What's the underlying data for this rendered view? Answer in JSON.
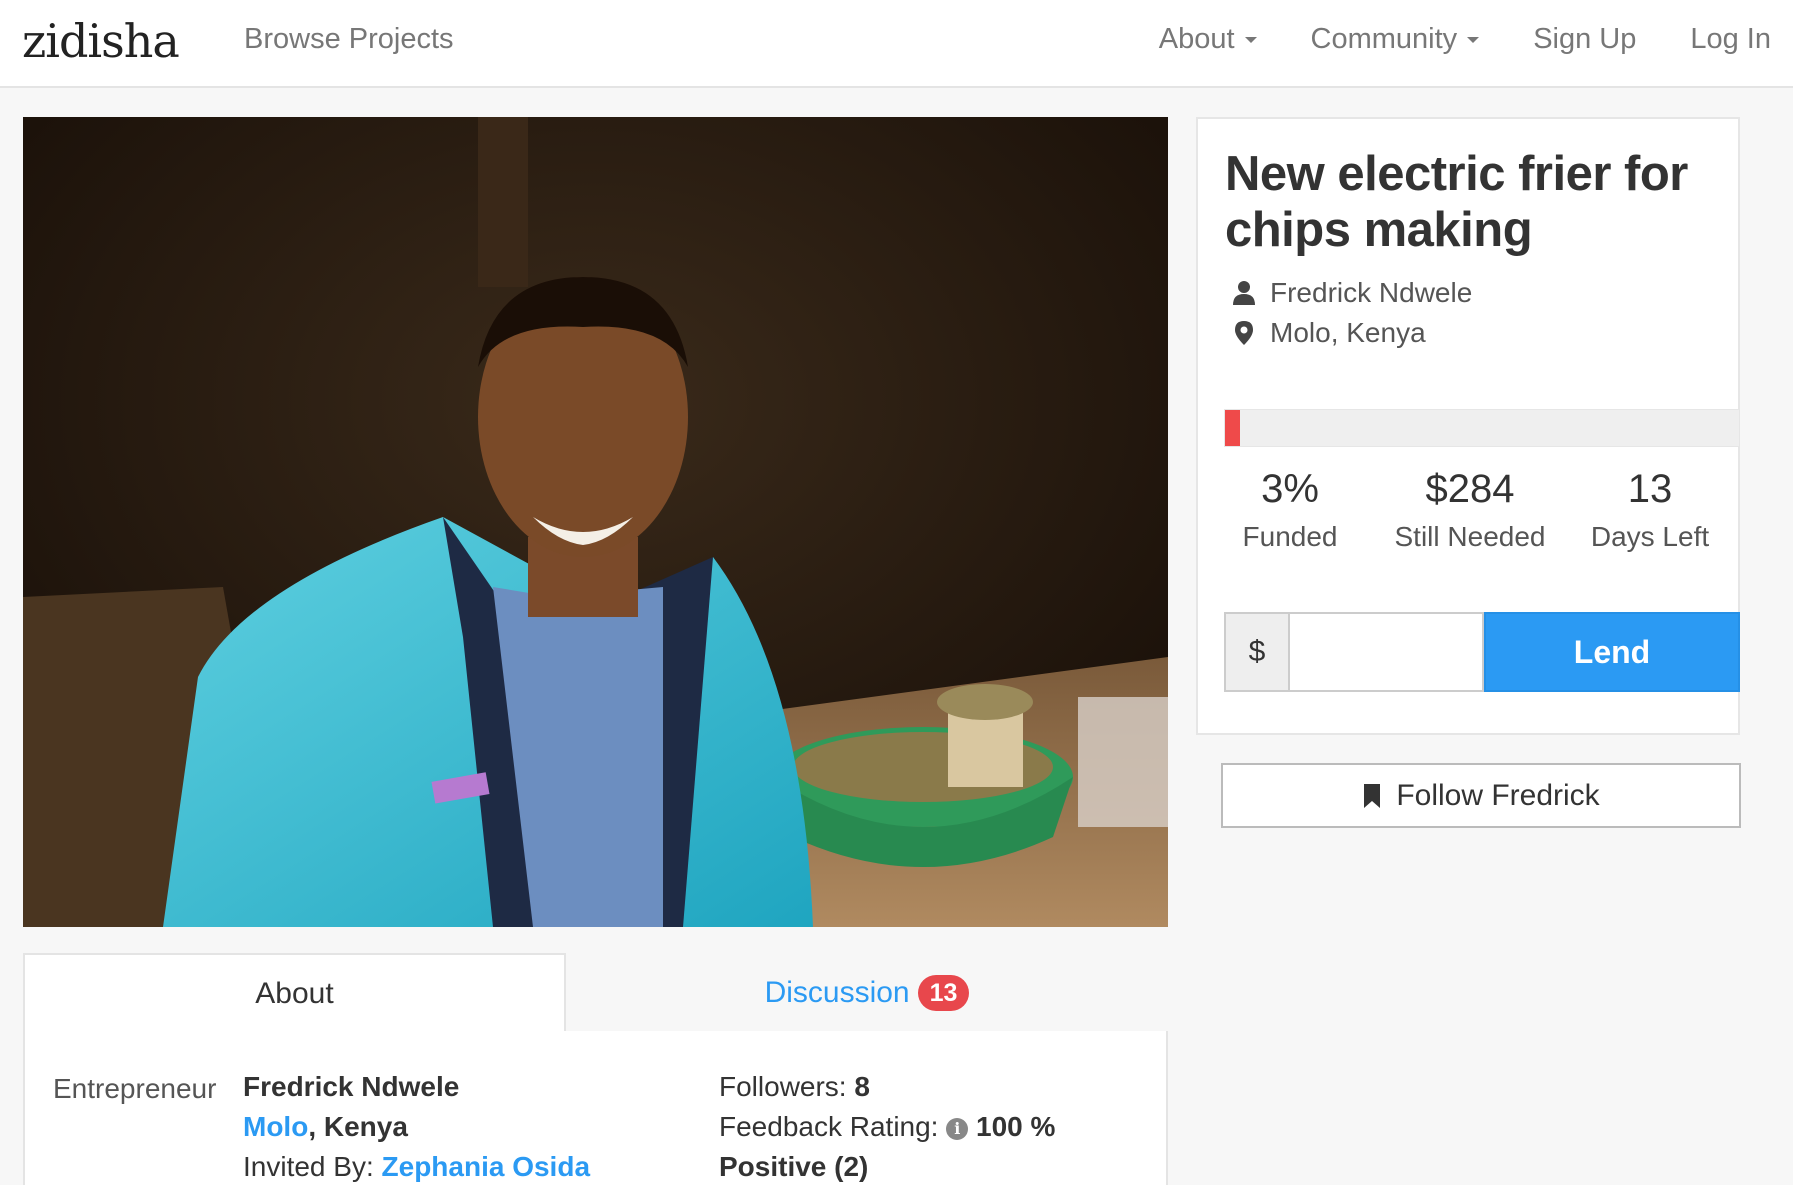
{
  "nav": {
    "logo": "zidisha",
    "browse": "Browse Projects",
    "about": "About",
    "community": "Community",
    "signup": "Sign Up",
    "login": "Log In"
  },
  "loan": {
    "title": "New electric frier for chips making",
    "borrower": "Fredrick Ndwele",
    "location": "Molo, Kenya",
    "progress_fraction": 0.03,
    "funded_value": "3%",
    "funded_label": "Funded",
    "needed_value": "$284",
    "needed_label": "Still Needed",
    "days_value": "13",
    "days_label": "Days Left",
    "currency_symbol": "$",
    "amount_value": "",
    "lend_label": "Lend",
    "follow_label": "Follow Fredrick"
  },
  "tabs": {
    "about": "About",
    "discussion": "Discussion",
    "discussion_count": "13"
  },
  "about": {
    "label": "Entrepreneur",
    "name": "Fredrick Ndwele",
    "city": "Molo",
    "country_suffix": ", Kenya",
    "invited_by_label": "Invited By: ",
    "invited_by_name": "Zephania Osida",
    "followers_label": "Followers: ",
    "followers_count": "8",
    "feedback_label": "Feedback Rating: ",
    "feedback_value": "100 %",
    "feedback_positive": "Positive (2)"
  },
  "colors": {
    "accent_blue": "#2b9af3",
    "progress_red": "#ef4a4a",
    "badge_red": "#e8474c"
  },
  "icons": [
    "user-icon",
    "map-marker-icon",
    "bookmark-icon",
    "info-icon",
    "caret-down-icon"
  ]
}
